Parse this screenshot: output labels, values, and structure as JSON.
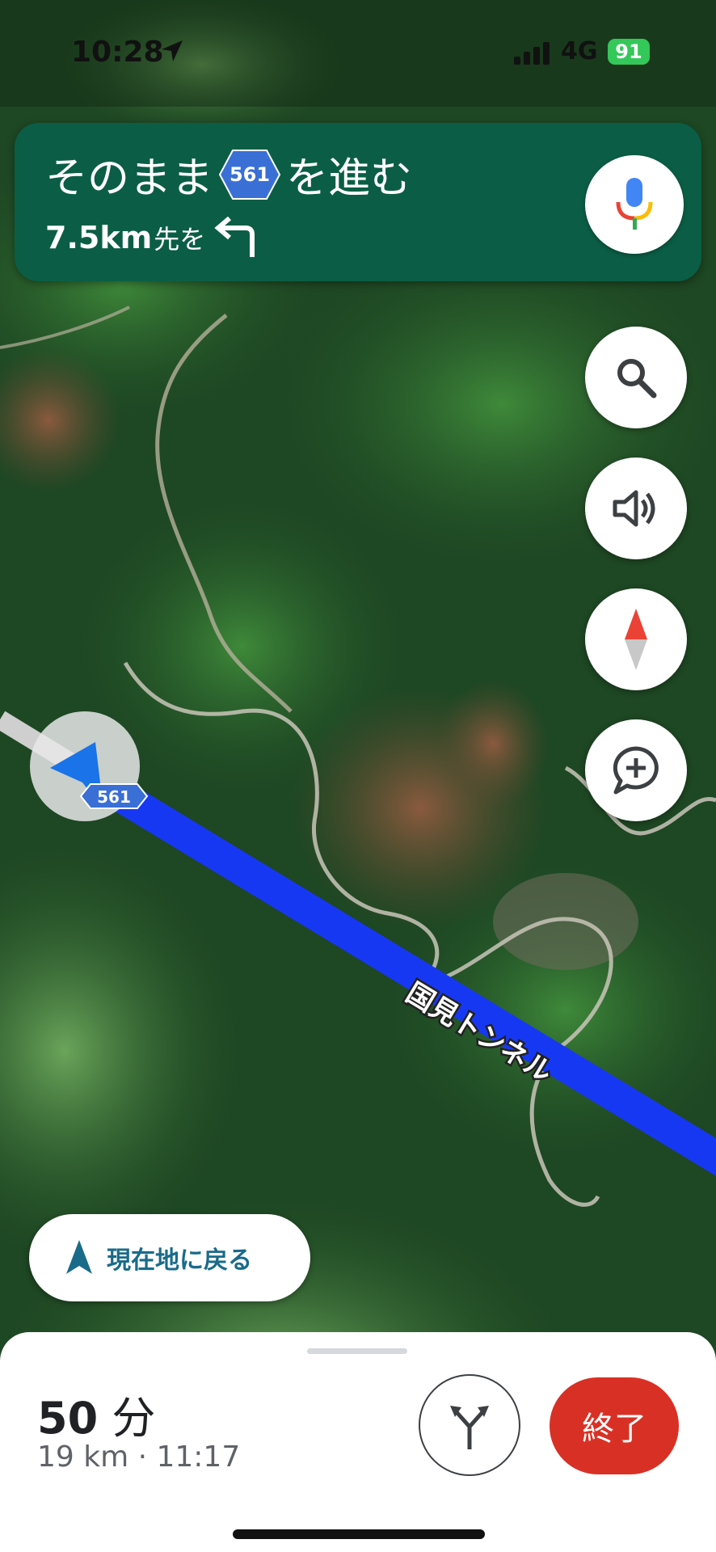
{
  "status_bar": {
    "time": "10:28",
    "network": "4G",
    "battery": "91"
  },
  "navigation": {
    "instruction_prefix": "そのまま",
    "route_shield": "561",
    "instruction_suffix": "を進む",
    "next_distance": "7.5km",
    "next_suffix": "先を",
    "next_turn_icon": "turn-left-icon"
  },
  "map": {
    "tunnel_label": "国見トンネル",
    "road_shield": "561",
    "route_color": "#1a3cff"
  },
  "recenter": {
    "label": "現在地に戻る"
  },
  "trip": {
    "duration_value": "50",
    "duration_unit": "分",
    "distance_arrival": "19 km · 11:17",
    "end_button": "終了"
  },
  "colors": {
    "banner": "#0b5e45",
    "end_button": "#d93025",
    "recenter_text": "#1a6b8a"
  }
}
